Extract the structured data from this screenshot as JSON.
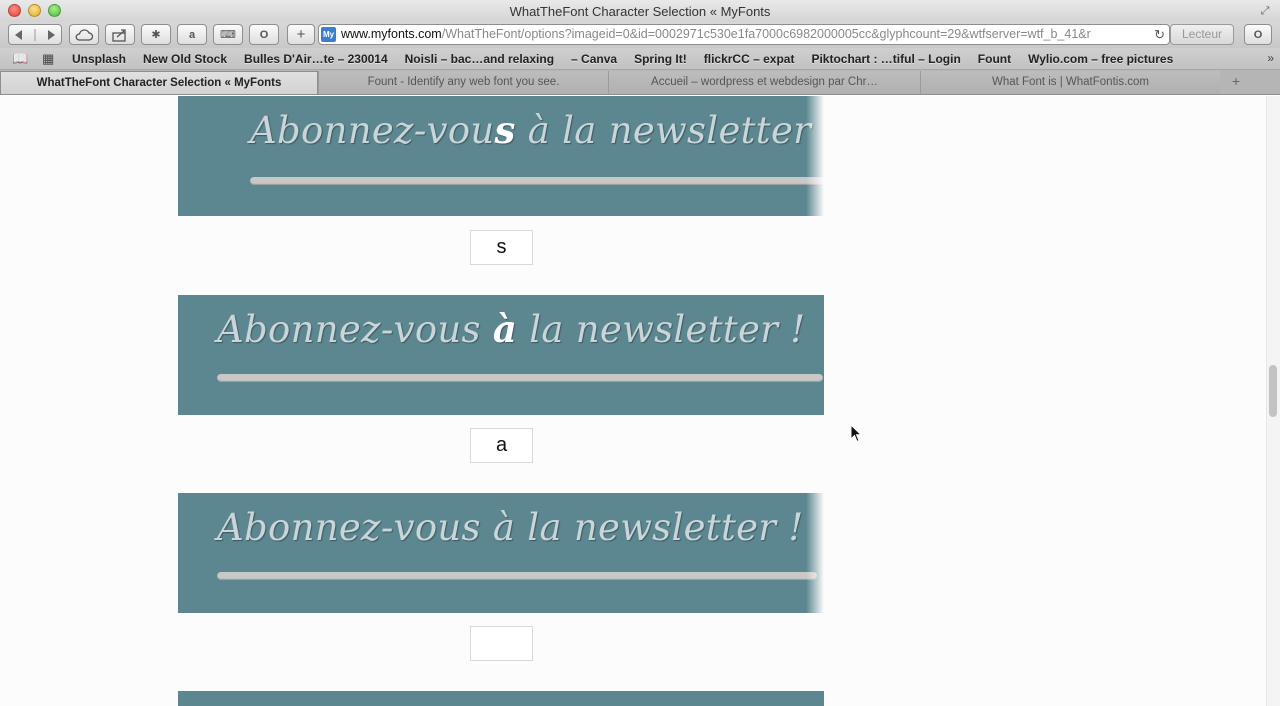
{
  "window": {
    "title": "WhatTheFont Character Selection « MyFonts"
  },
  "toolbar": {
    "back_icon": "back-arrow-icon",
    "forward_icon": "forward-arrow-icon",
    "address_host": "www.myfonts.com",
    "address_path": "/WhatTheFont/options?imageid=0&id=0002971c530e1fa7000c6982000005cc&glyphcount=29&wtfserver=wtf_b_41&r",
    "reader_label": "Lecteur"
  },
  "bookmarks": [
    "Unsplash",
    "New Old Stock",
    "Bulles D'Air…te – 230014",
    "Noisli – bac…and relaxing",
    "– Canva",
    "Spring It!",
    "flickrCC – expat",
    "Piktochart : …tiful – Login",
    "Fount",
    "Wylio.com – free pictures"
  ],
  "tabs": [
    {
      "label": "WhatTheFont Character Selection « MyFonts",
      "active": true
    },
    {
      "label": "Fount - Identify any web font you see.",
      "active": false
    },
    {
      "label": "Accueil – wordpress et webdesign par Chr…",
      "active": false
    },
    {
      "label": "What Font is | WhatFontis.com",
      "active": false
    }
  ],
  "glyphs": [
    {
      "before": "Abonnez-vou",
      "highlight": "s",
      "after": " à la newsletter !",
      "input_value": "s"
    },
    {
      "before": "Abonnez-vous ",
      "highlight": "à",
      "after": " la newsletter !",
      "input_value": "a"
    },
    {
      "before": "Abonnez-vous à la newsletter !",
      "highlight": "",
      "after": "",
      "input_value": ""
    }
  ],
  "colors": {
    "glyph_background": "#5c8790",
    "glyph_text": "#c9d5d8",
    "glyph_highlight": "#ffffff"
  }
}
